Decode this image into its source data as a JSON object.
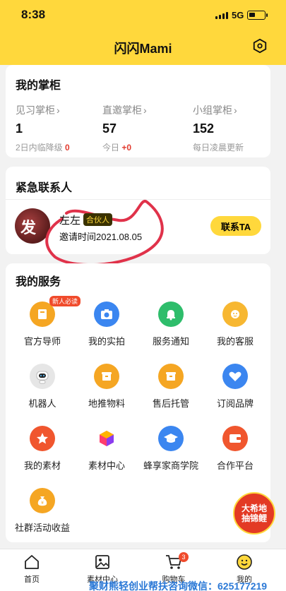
{
  "status": {
    "time": "8:38",
    "network": "5G"
  },
  "header": {
    "title": "闪闪Mami"
  },
  "shopkeeper": {
    "title": "我的掌柜",
    "stats": [
      {
        "label": "见习掌柜",
        "value": "1",
        "sub_prefix": "2日内临降级",
        "sub_value": "0"
      },
      {
        "label": "直邀掌柜",
        "value": "57",
        "sub_prefix": "今日",
        "sub_value": "+0"
      },
      {
        "label": "小组掌柜",
        "value": "152",
        "sub_prefix": "每日凌晨更新",
        "sub_value": ""
      }
    ]
  },
  "emergency": {
    "title": "紧急联系人",
    "avatar_glyph": "发",
    "name": "左左",
    "badge": "合伙人",
    "invite_time": "邀请时间2021.08.05",
    "contact_button": "联系TA"
  },
  "services": {
    "title": "我的服务",
    "new_badge": "新人必读",
    "items": [
      {
        "label": "官方导师",
        "icon": "book-icon",
        "color": "#f5a623"
      },
      {
        "label": "我的实拍",
        "icon": "camera-icon",
        "color": "#3b86f0"
      },
      {
        "label": "服务通知",
        "icon": "bell-icon",
        "color": "#2ebd6b"
      },
      {
        "label": "我的客服",
        "icon": "headset-icon",
        "color": "#f7b731"
      },
      {
        "label": "机器人",
        "icon": "robot-icon",
        "color": "#dcdcdc"
      },
      {
        "label": "地推物料",
        "icon": "box-icon",
        "color": "#f5a623"
      },
      {
        "label": "售后托管",
        "icon": "box-icon",
        "color": "#f5a623"
      },
      {
        "label": "订阅品牌",
        "icon": "heart-plus-icon",
        "color": "#3b86f0"
      },
      {
        "label": "我的素材",
        "icon": "star-icon",
        "color": "#f0562e"
      },
      {
        "label": "素材中心",
        "icon": "cube-icon",
        "color": "#c13cf0"
      },
      {
        "label": "蜂享家商学院",
        "icon": "graduation-cap-icon",
        "color": "#3b86f0"
      },
      {
        "label": "合作平台",
        "icon": "wallet-icon",
        "color": "#f0562e"
      },
      {
        "label": "社群活动收益",
        "icon": "money-bag-icon",
        "color": "#f5a623"
      }
    ]
  },
  "promo": {
    "line1": "大希地",
    "line2": "抽锦鲤"
  },
  "tabbar": {
    "items": [
      {
        "label": "首页",
        "icon": "home-icon"
      },
      {
        "label": "素材中心",
        "icon": "image-icon"
      },
      {
        "label": "购物车",
        "icon": "cart-icon",
        "count": "3"
      },
      {
        "label": "我的",
        "icon": "smiley-icon"
      }
    ]
  },
  "watermark": "聚财熊轻创业帮扶咨询微信：625177219"
}
